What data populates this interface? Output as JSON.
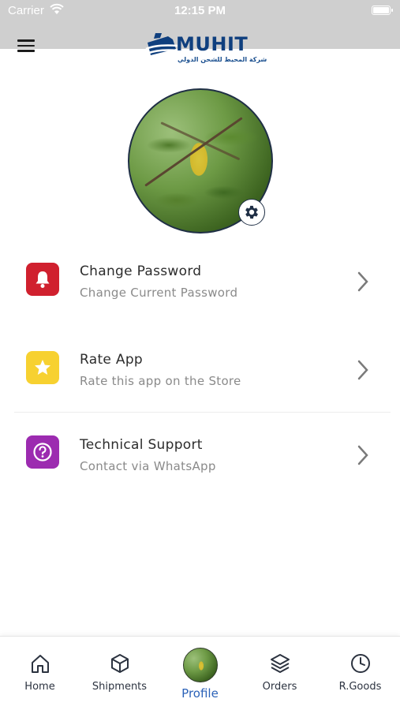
{
  "status_bar": {
    "carrier": "Carrier",
    "time": "12:15 PM"
  },
  "header": {
    "brand": "MUHIT",
    "tagline": "شركة المحيط للشحن الدولي",
    "menu_icon": "hamburger-menu-icon"
  },
  "profile": {
    "avatar_icon": "profile-photo",
    "settings_icon": "gear-icon"
  },
  "menu_items": [
    {
      "title": "Change Password",
      "subtitle": "Change Current Password",
      "icon": "bell-icon",
      "color": "#d0202e"
    },
    {
      "title": "Rate App",
      "subtitle": "Rate this app on the Store",
      "icon": "star-icon",
      "color": "#f7d130"
    },
    {
      "title": "Technical Support",
      "subtitle": "Contact via WhatsApp",
      "icon": "help-circle-icon",
      "color": "#9c2bb0"
    }
  ],
  "tabs": [
    {
      "label": "Home",
      "icon": "home-icon",
      "active": false
    },
    {
      "label": "Shipments",
      "icon": "box-icon",
      "active": false
    },
    {
      "label": "Profile",
      "icon": "avatar",
      "active": true
    },
    {
      "label": "Orders",
      "icon": "layers-icon",
      "active": false
    },
    {
      "label": "R.Goods",
      "icon": "clock-icon",
      "active": false
    }
  ],
  "colors": {
    "active_tab": "#2b62b8",
    "brand": "#0f3f7e"
  }
}
